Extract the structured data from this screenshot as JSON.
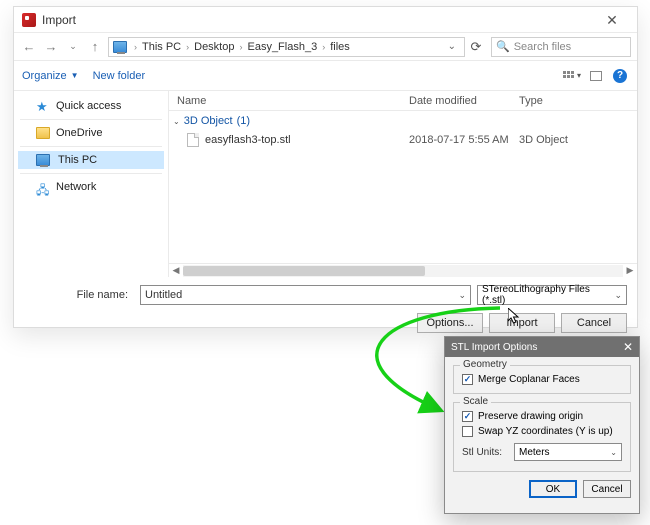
{
  "import": {
    "title": "Import",
    "close_glyph": "✕",
    "nav": {
      "back": "←",
      "forward": "→",
      "up": "↑",
      "refresh": "⟳",
      "path_drop": "⌄"
    },
    "breadcrumb": [
      "This PC",
      "Desktop",
      "Easy_Flash_3",
      "files"
    ],
    "breadcrumb_sep": "›",
    "search_placeholder": "Search files",
    "toolbar": {
      "organize": "Organize",
      "new_folder": "New folder",
      "view_drop": "▾",
      "help": "?"
    },
    "tree": {
      "quick": "Quick access",
      "onedrive": "OneDrive",
      "thispc": "This PC",
      "network": "Network"
    },
    "columns": {
      "name": "Name",
      "date": "Date modified",
      "type": "Type"
    },
    "group": {
      "label": "3D Object",
      "count": "(1)",
      "twisty": "⌄"
    },
    "files": [
      {
        "name": "easyflash3-top.stl",
        "date": "2018-07-17 5:55 AM",
        "type": "3D Object"
      }
    ],
    "file_name_label": "File name:",
    "file_name_value": "Untitled",
    "type_filter": "STereoLithography Files (*.stl)",
    "buttons": {
      "options": "Options...",
      "import": "Import",
      "cancel": "Cancel"
    }
  },
  "stl": {
    "title": "STL Import Options",
    "close_glyph": "✕",
    "geometry_legend": "Geometry",
    "merge_faces": "Merge Coplanar Faces",
    "scale_legend": "Scale",
    "preserve_origin": "Preserve drawing origin",
    "swap_yz": "Swap YZ coordinates (Y is up)",
    "units_label": "Stl Units:",
    "units_value": "Meters",
    "ok": "OK",
    "cancel": "Cancel"
  }
}
